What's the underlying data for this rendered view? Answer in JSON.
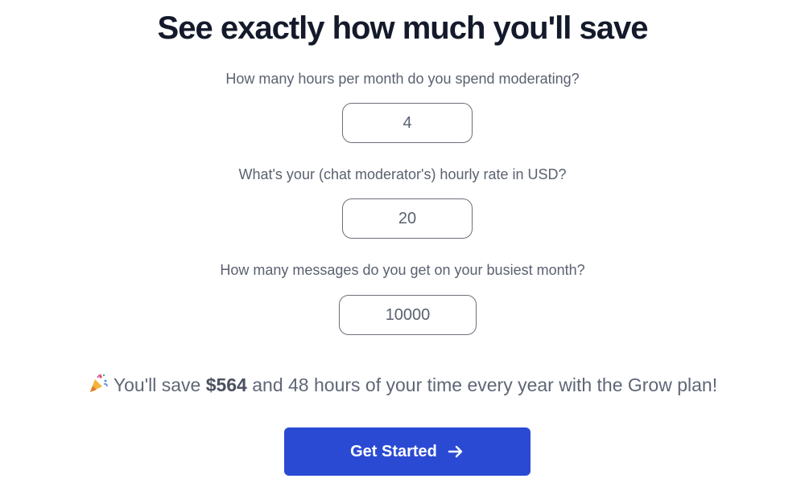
{
  "heading": "See exactly how much you'll save",
  "questions": [
    {
      "label": "How many hours per month do you spend moderating?",
      "value": "4"
    },
    {
      "label": "What's your (chat moderator's) hourly rate in USD?",
      "value": "20"
    },
    {
      "label": "How many messages do you get on your busiest month?",
      "value": "10000"
    }
  ],
  "result": {
    "prefix": "You'll save",
    "amount": "$564",
    "suffix": "and 48 hours of your time every year with the Grow plan!",
    "icon": "party-popper-icon"
  },
  "cta": {
    "label": "Get Started",
    "icon": "arrow-right-icon",
    "color": "#2a4ad4"
  }
}
